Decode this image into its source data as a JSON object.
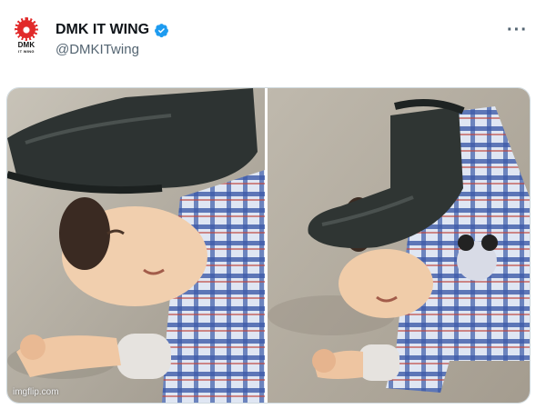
{
  "tweet": {
    "author": {
      "display_name": "DMK IT WING",
      "handle": "@DMKITwing",
      "avatar_text_main": "DMK",
      "avatar_text_sub": "IT WING",
      "verified": true,
      "verified_color": "#1d9bf0",
      "avatar_color": "#e12a2a"
    },
    "more_icon": "more-dots-icon",
    "media": {
      "watermark": "imgflip.com",
      "panels": 2
    }
  }
}
